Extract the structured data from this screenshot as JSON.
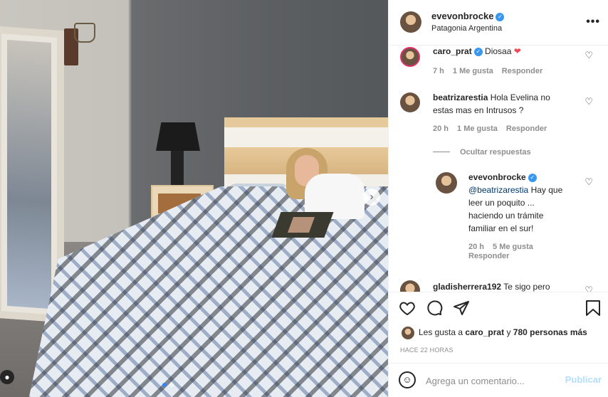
{
  "post": {
    "photo_alt": "",
    "carousel_next": "›"
  },
  "header": {
    "username": "evevonbrocke",
    "location": "Patagonia Argentina",
    "more": "•••"
  },
  "comments": [
    {
      "username": "caro_prat",
      "text": "Diosaa",
      "emoji": "❤",
      "time": "7 h",
      "likes": "1 Me gusta",
      "reply": "Responder"
    },
    {
      "username": "beatrizarestia",
      "text_line1": "Hola Evelina no",
      "text_line2": "estas mas en Intrusos ?",
      "time": "20 h",
      "likes": "1 Me gusta",
      "reply": "Responder"
    },
    {
      "hide_replies": "Ocultar respuestas"
    },
    {
      "username": "evevonbrocke",
      "mention": "@beatrizarestia",
      "text_line1": "Hay que",
      "text_line2": "leer un poquito ...",
      "text_line3": "haciendo un trámite",
      "text_line4": "familiar en el sur!",
      "time": "20 h",
      "likes": "5 Me gusta",
      "reply": "Responder"
    },
    {
      "username": "gladisherrera192",
      "text": "Te sigo pero"
    }
  ],
  "likes": {
    "prefix": "Les gusta a",
    "user": "caro_prat",
    "joiner": "y",
    "others": "780 personas más"
  },
  "time_ago": "HACE 22 HORAS",
  "add_comment": {
    "placeholder": "Agrega un comentario...",
    "post_label": "Publicar"
  },
  "icons": {
    "like": "heart-icon",
    "comment": "comment-icon",
    "share": "share-icon",
    "save": "bookmark-icon",
    "emoji": "emoji-icon"
  },
  "colors": {
    "verified": "#3897f0",
    "heart": "#ed4956",
    "meta": "#8e8e8e",
    "publish_disabled": "#b2dffc"
  }
}
